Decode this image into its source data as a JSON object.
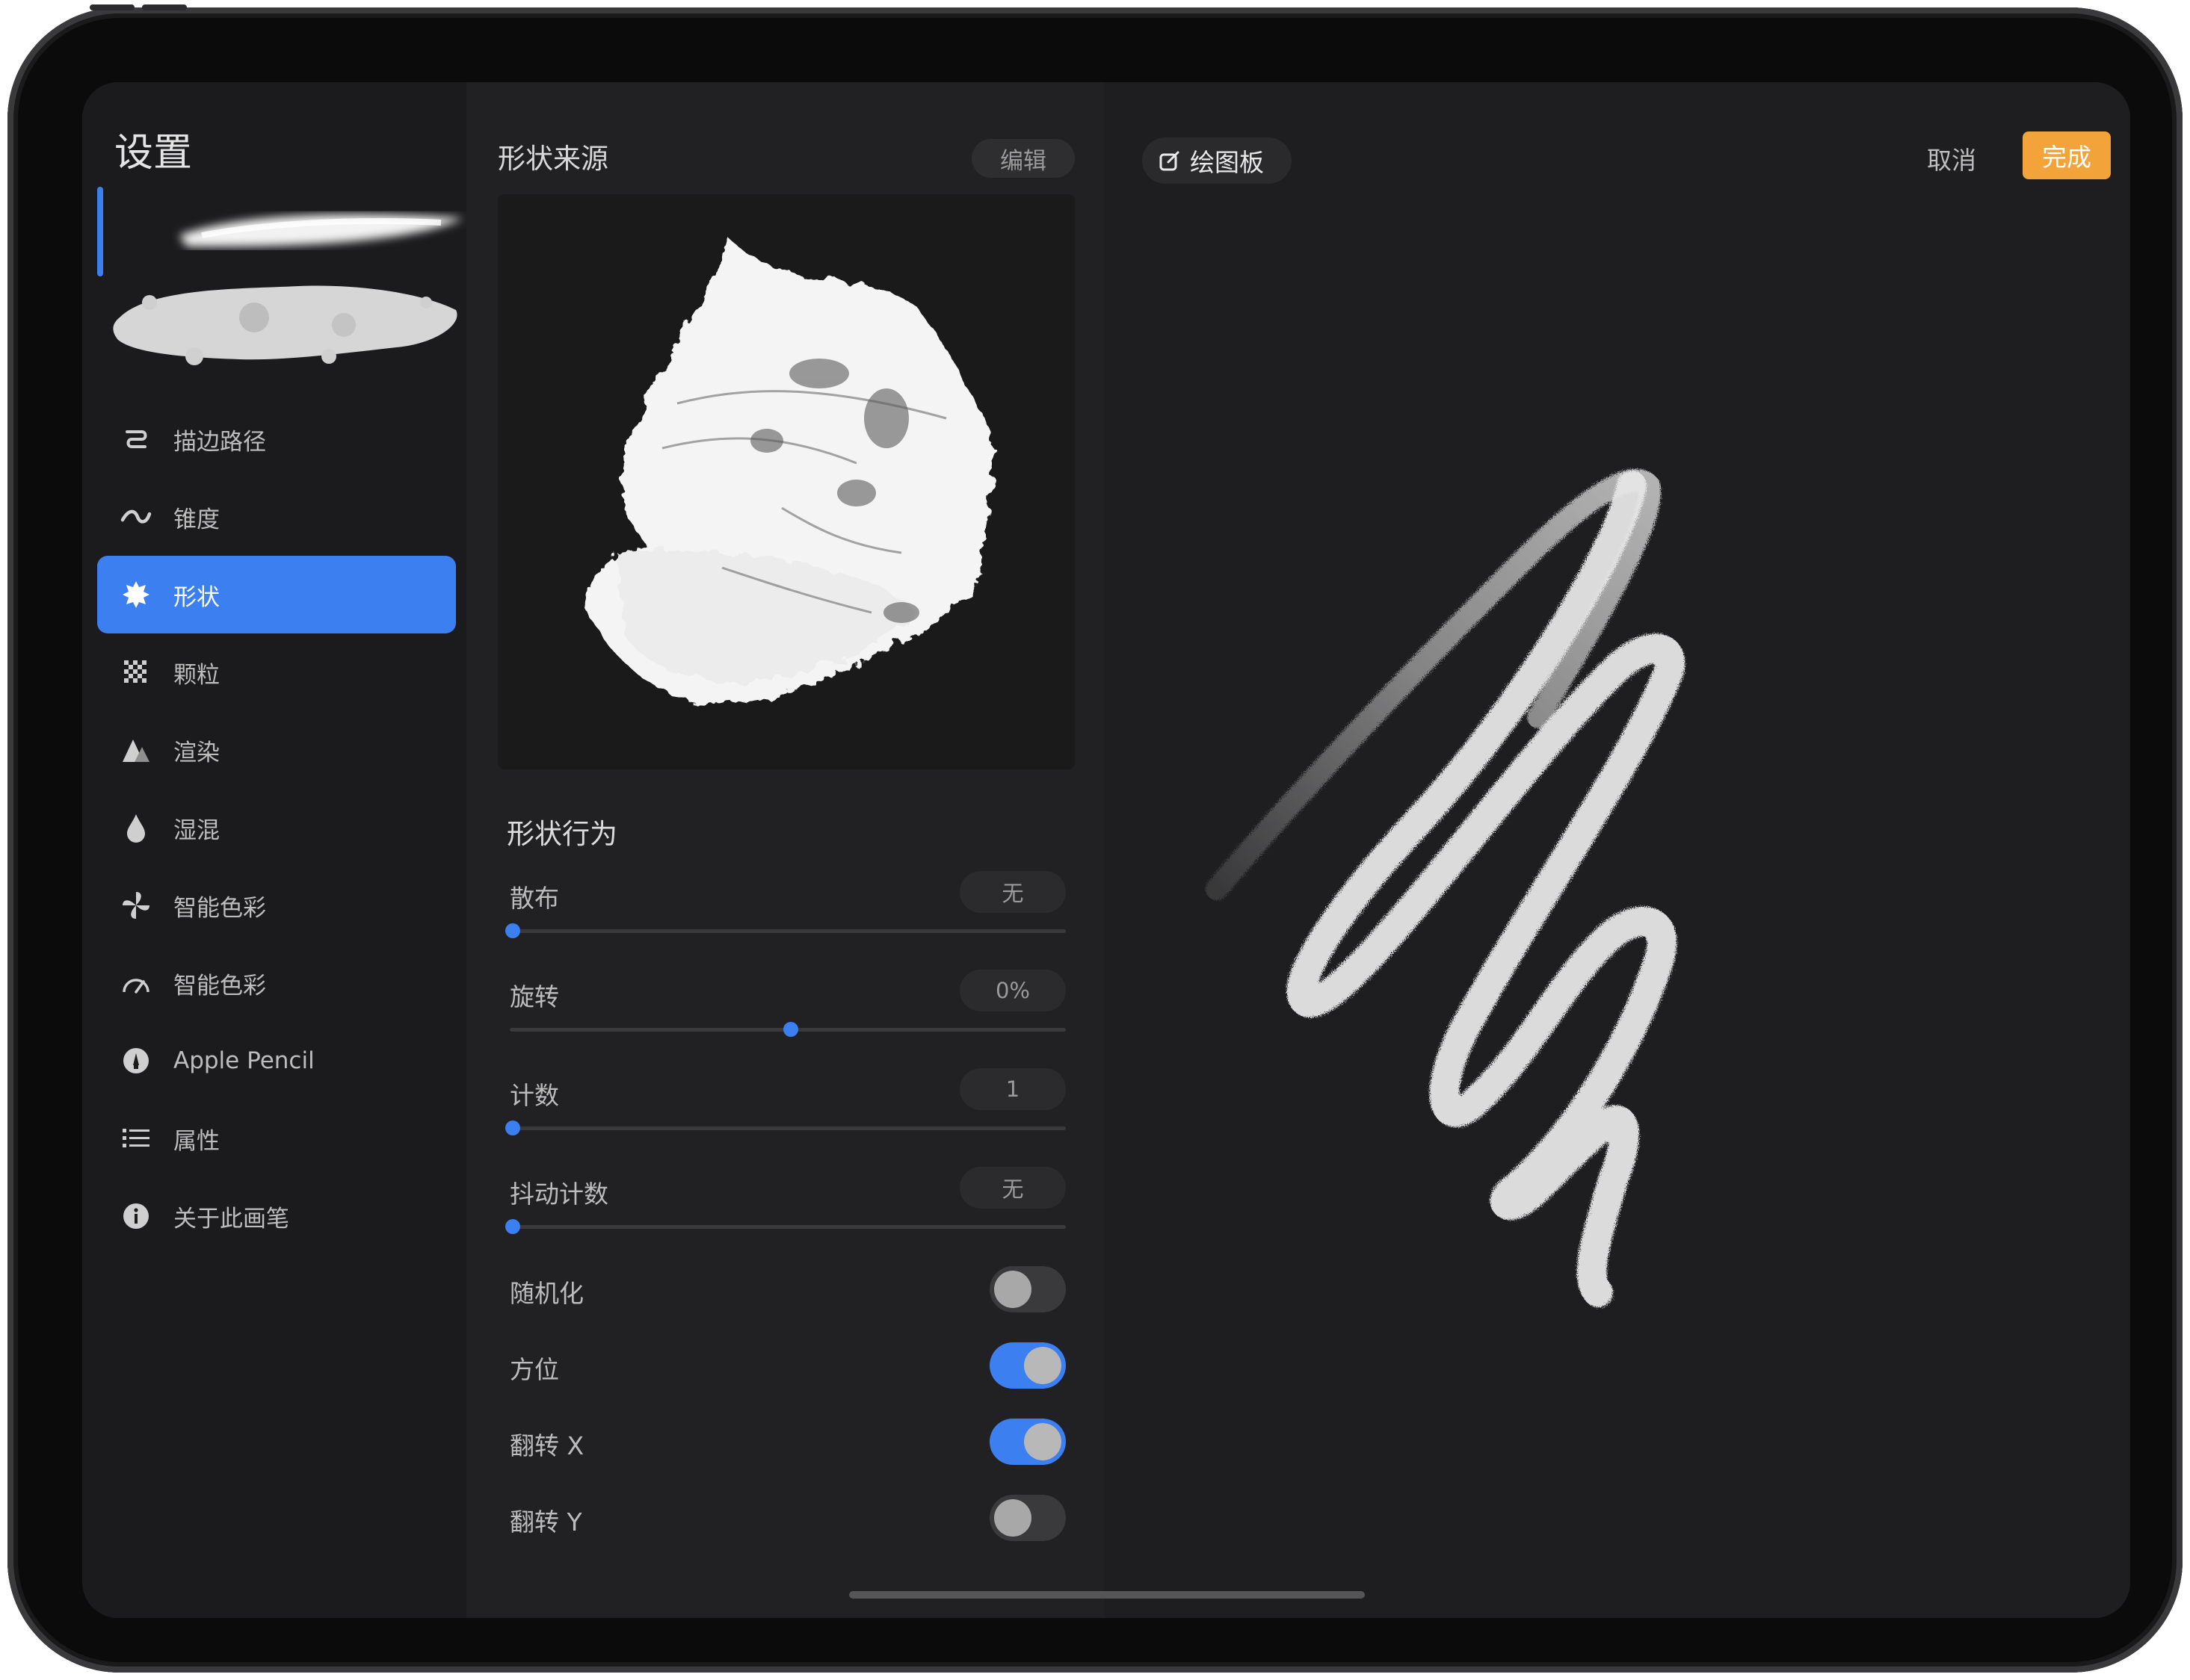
{
  "sidebar": {
    "title": "设置",
    "items": [
      {
        "label": "描边路径",
        "icon": "stroke-path-icon"
      },
      {
        "label": "锥度",
        "icon": "taper-icon"
      },
      {
        "label": "形状",
        "icon": "shape-icon",
        "active": true
      },
      {
        "label": "颗粒",
        "icon": "grain-icon"
      },
      {
        "label": "渲染",
        "icon": "render-icon"
      },
      {
        "label": "湿混",
        "icon": "wet-mix-icon"
      },
      {
        "label": "智能色彩",
        "icon": "color-dynamics-icon"
      },
      {
        "label": "智能色彩",
        "icon": "dynamics-gauge-icon"
      },
      {
        "label": "Apple Pencil",
        "icon": "apple-pencil-icon"
      },
      {
        "label": "属性",
        "icon": "properties-list-icon"
      },
      {
        "label": "关于此画笔",
        "icon": "info-icon"
      }
    ]
  },
  "shape_source": {
    "title": "形状来源",
    "edit_label": "编辑"
  },
  "shape_behavior": {
    "title": "形状行为",
    "sliders": [
      {
        "label": "散布",
        "value": "无",
        "level": 0.0
      },
      {
        "label": "旋转",
        "value": "0%",
        "level": 0.5
      },
      {
        "label": "计数",
        "value": "1",
        "level": 0.0
      },
      {
        "label": "抖动计数",
        "value": "无",
        "level": 0.0
      }
    ],
    "toggles": [
      {
        "label": "随机化",
        "on": false
      },
      {
        "label": "方位",
        "on": true
      },
      {
        "label": "翻转 X",
        "on": true
      },
      {
        "label": "翻转 Y",
        "on": false
      }
    ]
  },
  "canvas": {
    "pad_label": "绘图板",
    "cancel_label": "取消",
    "done_label": "完成"
  },
  "colors": {
    "accent": "#3b7ff0",
    "done": "#f2a43a",
    "background": "#1e1e20"
  }
}
